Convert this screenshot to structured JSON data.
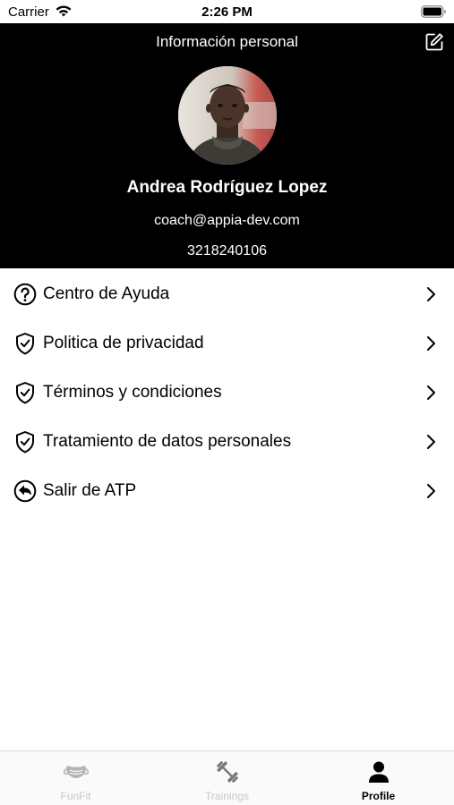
{
  "status_bar": {
    "carrier": "Carrier",
    "time": "2:26 PM"
  },
  "header": {
    "title": "Información personal",
    "edit_icon": "edit-icon",
    "background_color": "#000000"
  },
  "profile": {
    "name": "Andrea Rodríguez Lopez",
    "email": "coach@appia-dev.com",
    "phone": "3218240106"
  },
  "menu": {
    "items": [
      {
        "label": "Centro de Ayuda",
        "icon": "help-circle-icon"
      },
      {
        "label": "Politica de privacidad",
        "icon": "shield-check-icon"
      },
      {
        "label": "Términos y condiciones",
        "icon": "shield-check-icon"
      },
      {
        "label": "Tratamiento de datos personales",
        "icon": "shield-check-icon"
      },
      {
        "label": "Salir de ATP",
        "icon": "logout-arrow-icon"
      }
    ]
  },
  "tab_bar": {
    "tabs": [
      {
        "label": "FunFit",
        "icon": "mask-icon",
        "active": false
      },
      {
        "label": "Trainings",
        "icon": "dumbbell-icon",
        "active": false
      },
      {
        "label": "Profile",
        "icon": "person-icon",
        "active": true
      }
    ],
    "active_color": "#000000",
    "inactive_color": "#c8c8c8"
  }
}
